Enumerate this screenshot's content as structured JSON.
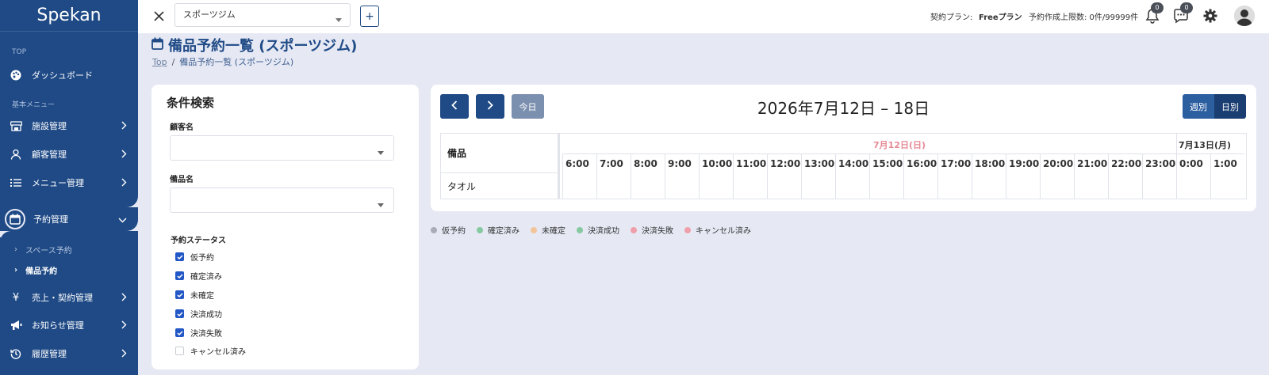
{
  "app": {
    "name": "Spekan"
  },
  "sidebar": {
    "section_top": "TOP",
    "section_basic": "基本メニュー",
    "items": [
      {
        "label": "ダッシュボード",
        "icon": "palette-icon"
      },
      {
        "label": "施設管理",
        "icon": "store-icon"
      },
      {
        "label": "顧客管理",
        "icon": "user-icon"
      },
      {
        "label": "メニュー管理",
        "icon": "list-icon"
      },
      {
        "label": "予約管理",
        "icon": "calendar-icon"
      },
      {
        "label": "売上・契約管理",
        "icon": "yen-icon"
      },
      {
        "label": "お知らせ管理",
        "icon": "megaphone-icon"
      },
      {
        "label": "履歴管理",
        "icon": "history-icon"
      }
    ],
    "sub_items": [
      {
        "label": "スペース予約"
      },
      {
        "label": "備品予約"
      }
    ]
  },
  "topbar": {
    "facility_select": "スポーツジム",
    "plan_label": "契約プラン:",
    "plan_value": "Freeプラン",
    "limit_text": "予約作成上限数: 0件/99999件",
    "notif_count": "0",
    "message_count": "0"
  },
  "page": {
    "title": "備品予約一覧 (スポーツジム)",
    "breadcrumb_top": "Top",
    "breadcrumb_current": "備品予約一覧 (スポーツジム)"
  },
  "search": {
    "title": "条件検索",
    "customer_label": "顧客名",
    "customer_value": "",
    "item_label": "備品名",
    "item_value": "",
    "status_label": "予約ステータス",
    "statuses": [
      {
        "label": "仮予約",
        "checked": true
      },
      {
        "label": "確定済み",
        "checked": true
      },
      {
        "label": "未確定",
        "checked": true
      },
      {
        "label": "決済成功",
        "checked": true
      },
      {
        "label": "決済失敗",
        "checked": true
      },
      {
        "label": "キャンセル済み",
        "checked": false
      }
    ]
  },
  "calendar": {
    "today_label": "今日",
    "title": "2026年7月12日 – 18日",
    "view_week": "週別",
    "view_day": "日別",
    "resource_header": "備品",
    "day1_label": "7月12日(日)",
    "day2_label": "7月13日(月)",
    "day1_color": "#e58a97",
    "hours": [
      "6:00",
      "7:00",
      "8:00",
      "9:00",
      "10:00",
      "11:00",
      "12:00",
      "13:00",
      "14:00",
      "15:00",
      "16:00",
      "17:00",
      "18:00",
      "19:00",
      "20:00",
      "21:00",
      "22:00",
      "23:00",
      "0:00",
      "1:00"
    ],
    "resources": [
      "タオル"
    ]
  },
  "legend": [
    {
      "label": "仮予約",
      "color": "#a9adb8"
    },
    {
      "label": "確定済み",
      "color": "#86c8a0"
    },
    {
      "label": "未確定",
      "color": "#f2c49a"
    },
    {
      "label": "決済成功",
      "color": "#86c8a0"
    },
    {
      "label": "決済失敗",
      "color": "#ef9fa9"
    },
    {
      "label": "キャンセル済み",
      "color": "#ef9fa9"
    }
  ],
  "colors": {
    "primary": "#1f4a86",
    "background": "#e6e9f4"
  }
}
